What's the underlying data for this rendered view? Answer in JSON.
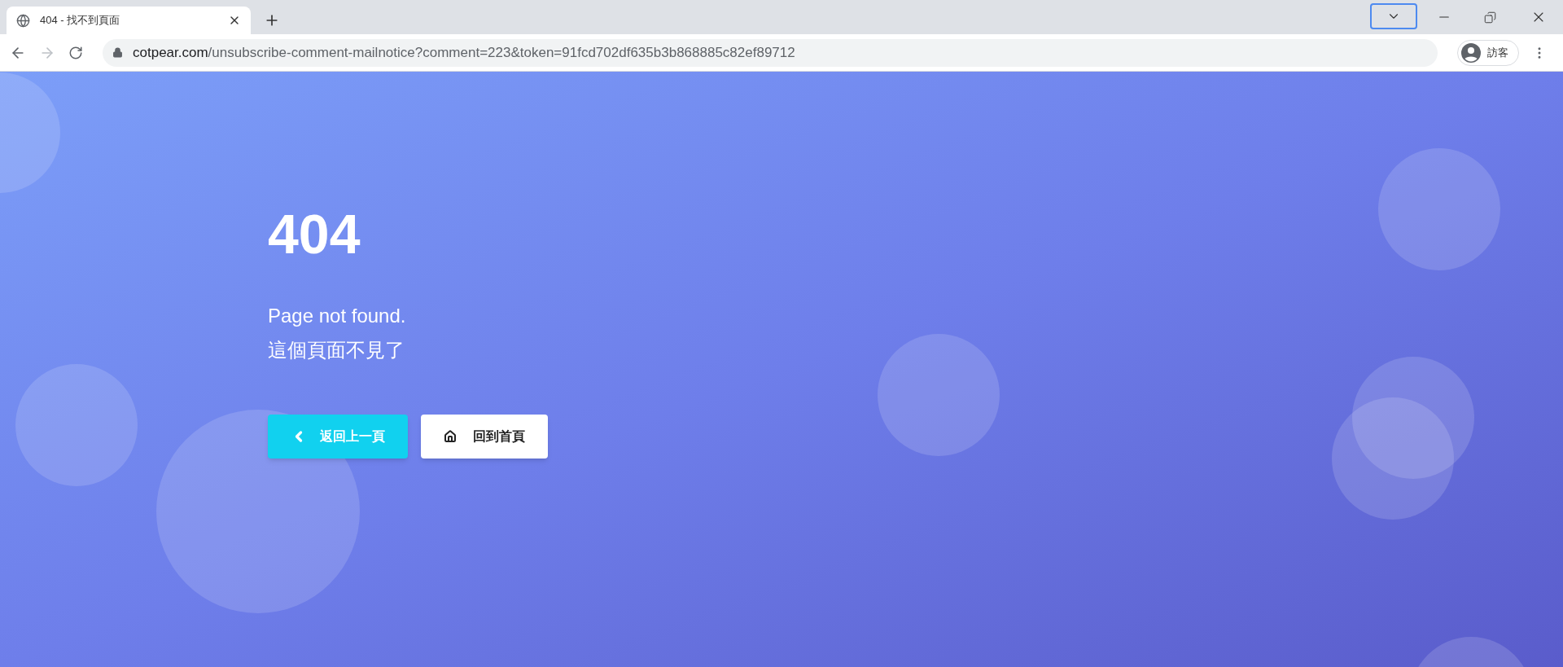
{
  "browser": {
    "tab": {
      "title": "404 - 找不到頁面"
    },
    "nav": {
      "forward_enabled": false
    },
    "address": {
      "domain": "cotpear.com",
      "path": "/unsubscribe-comment-mailnotice?comment=223&token=91fcd702df635b3b868885c82ef89712"
    },
    "profile": {
      "label": "訪客"
    }
  },
  "page": {
    "code": "404",
    "message": "Page not found.",
    "message_zh": "這個頁面不見了",
    "buttons": [
      {
        "kind": "back",
        "label": "返回上一頁"
      },
      {
        "kind": "home",
        "label": "回到首頁"
      }
    ]
  }
}
